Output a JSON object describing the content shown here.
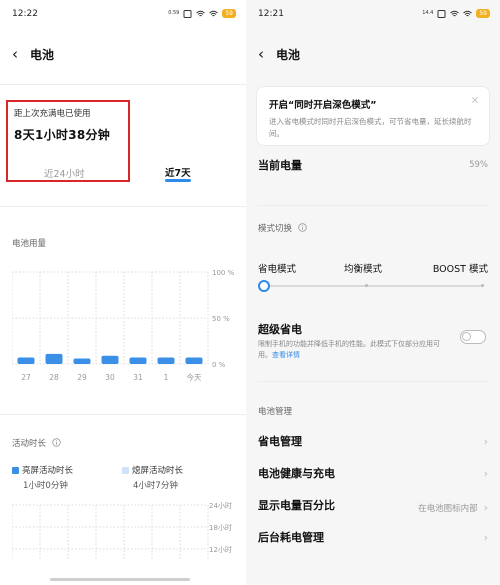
{
  "left": {
    "status": {
      "time": "12:22",
      "net": "0.59",
      "battery": "59"
    },
    "title": "电池",
    "usage_label": "距上次充满电已使用",
    "usage_value": "8天1小时38分钟",
    "tabs": [
      "近24小时",
      "近7天"
    ],
    "active_tab": "近7天",
    "battery_usage_title": "电池用量",
    "chart_data": {
      "type": "bar",
      "categories": [
        "27",
        "28",
        "29",
        "30",
        "31",
        "1",
        "今天"
      ],
      "values": [
        7,
        11,
        6,
        9,
        7,
        7,
        7
      ],
      "ylabel_ticks": [
        "100 %",
        "50 %",
        "0 %"
      ],
      "ylim": [
        0,
        100
      ],
      "grid": true,
      "color": "#3a8fe6"
    },
    "active_duration_title": "活动时长",
    "legend": [
      {
        "name": "亮屏活动时长",
        "value": "1小时0分钟",
        "color": "#3a8fe6"
      },
      {
        "name": "熄屏活动时长",
        "value": "4小时7分钟",
        "color": "#cde3f8"
      }
    ],
    "duration_ticks": [
      "24小时",
      "18小时",
      "12小时"
    ]
  },
  "right": {
    "status": {
      "time": "12:21",
      "net": "14.4",
      "battery": "59"
    },
    "title": "电池",
    "card": {
      "title": "开启“同时开启深色模式”",
      "body": "进入省电模式时同时开启深色模式，可节省电量，延长续航时间。"
    },
    "current_level_label": "当前电量",
    "current_level_value": "59%",
    "mode_switch_title": "模式切换",
    "modes": [
      "省电模式",
      "均衡模式",
      "BOOST 模式"
    ],
    "selected_mode": "省电模式",
    "ultra": {
      "label": "超级省电",
      "desc": "限制手机的功能并降低手机的性能。此模式下仅部分应用可用。",
      "link": "查看详情",
      "enabled": false
    },
    "management_title": "电池管理",
    "items": [
      {
        "label": "省电管理",
        "value": ""
      },
      {
        "label": "电池健康与充电",
        "value": ""
      },
      {
        "label": "显示电量百分比",
        "value": "在电池图标内部"
      },
      {
        "label": "后台耗电管理",
        "value": ""
      }
    ]
  }
}
